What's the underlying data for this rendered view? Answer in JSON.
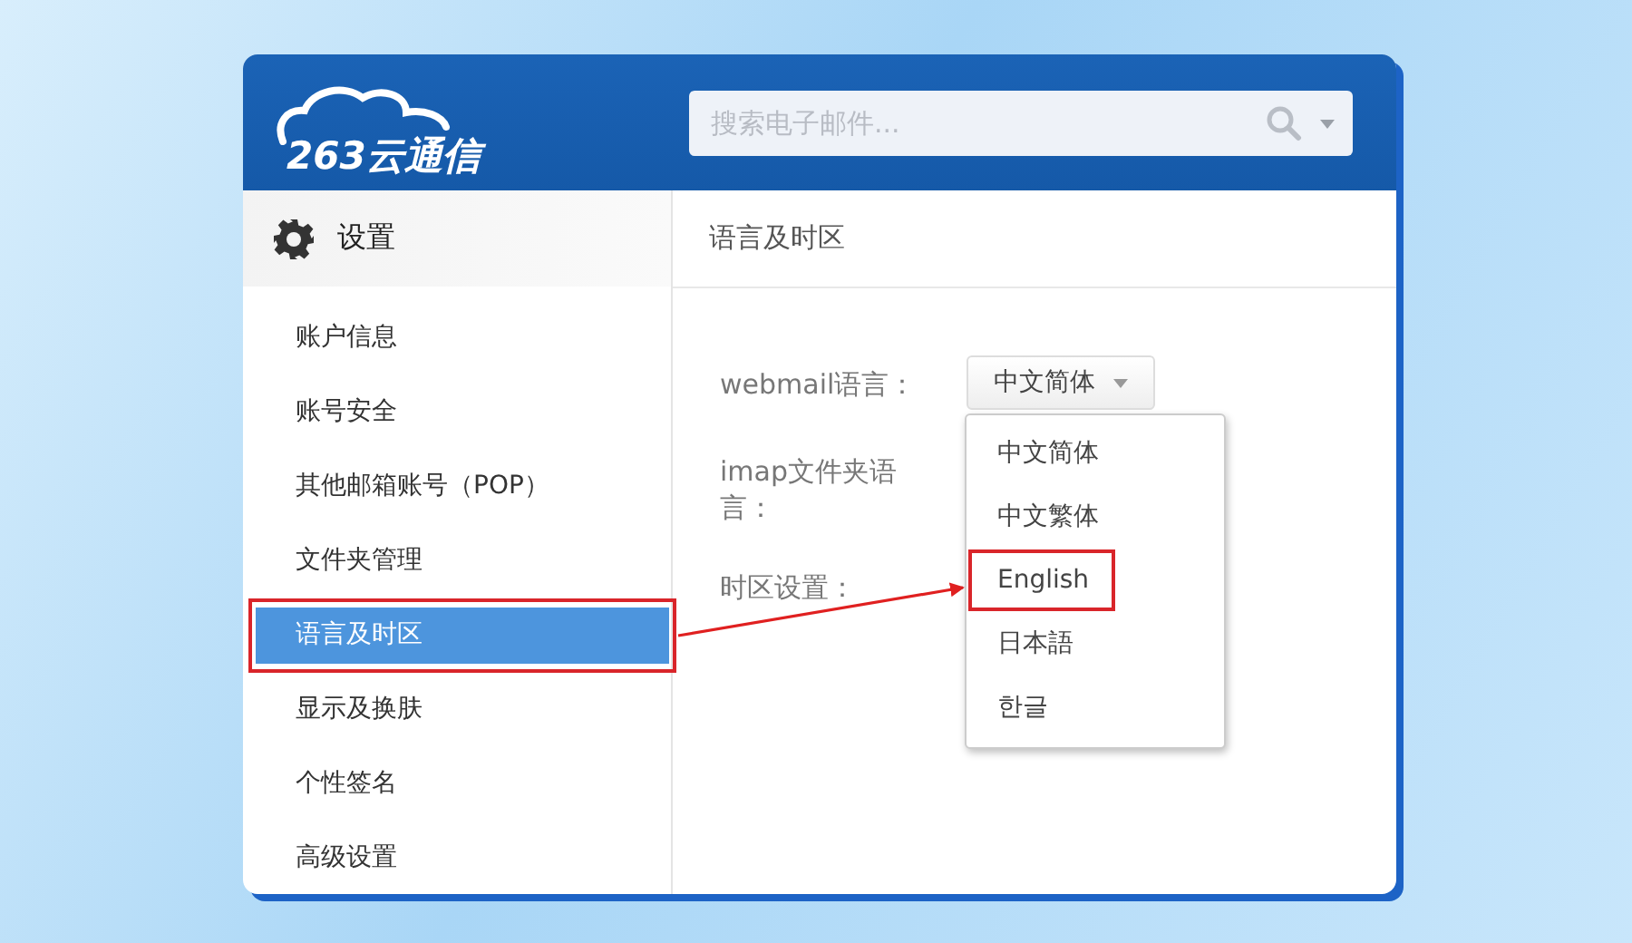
{
  "header": {
    "logo_text": "263云通信",
    "search": {
      "placeholder": "搜索电子邮件..."
    }
  },
  "sidebar": {
    "title": "设置",
    "items": [
      {
        "label": "账户信息",
        "selected": false,
        "annotated": false
      },
      {
        "label": "账号安全",
        "selected": false,
        "annotated": false
      },
      {
        "label": "其他邮箱账号（POP）",
        "selected": false,
        "annotated": false
      },
      {
        "label": "文件夹管理",
        "selected": false,
        "annotated": false
      },
      {
        "label": "语言及时区",
        "selected": true,
        "annotated": true
      },
      {
        "label": "显示及换肤",
        "selected": false,
        "annotated": false
      },
      {
        "label": "个性签名",
        "selected": false,
        "annotated": false
      },
      {
        "label": "高级设置",
        "selected": false,
        "annotated": false
      }
    ]
  },
  "content": {
    "title": "语言及时区",
    "fields": [
      {
        "label": "webmail语言：",
        "kind": "select",
        "value": "中文简体",
        "expanded": true,
        "options": [
          {
            "label": "中文简体",
            "annotated": false
          },
          {
            "label": "中文繁体",
            "annotated": false
          },
          {
            "label": "English",
            "annotated": true
          },
          {
            "label": "日本語",
            "annotated": false
          },
          {
            "label": "한글",
            "annotated": false
          }
        ]
      },
      {
        "label": "imap文件夹语言：",
        "kind": "text"
      },
      {
        "label": "时区设置：",
        "kind": "text"
      }
    ]
  },
  "annotation": {
    "arrow": true
  }
}
